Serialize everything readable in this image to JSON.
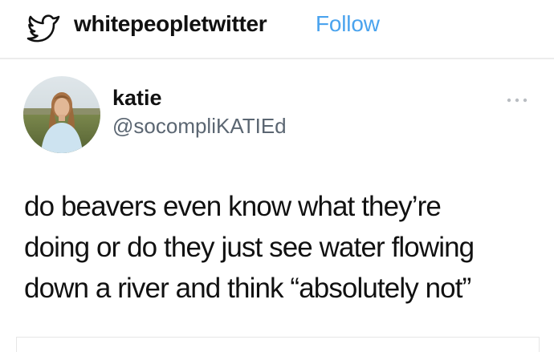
{
  "header": {
    "logo_icon": "bird-outline-icon",
    "account_name": "whitepeopletwitter",
    "follow_label": "Follow",
    "follow_color": "#4aa3ee"
  },
  "tweet": {
    "avatar_icon": "profile-photo",
    "display_name": "katie",
    "handle": "@socompliKATIEd",
    "more_icon": "more-dots-icon",
    "text_lines": [
      "do beavers even know what they’re",
      "doing or do they just see water flowing",
      "down a river and think “absolutely not”"
    ]
  }
}
